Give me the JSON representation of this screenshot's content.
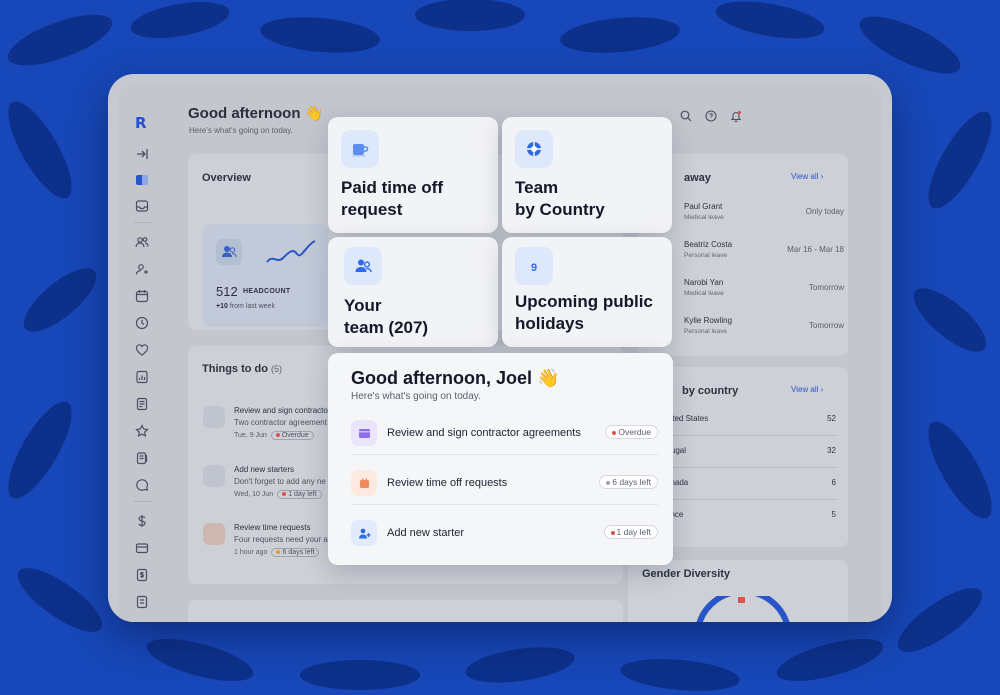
{
  "app": {
    "greeting_title": "Good afternoon 👋",
    "greeting_subtitle": "Here's what's going on today."
  },
  "overview": {
    "title": "Overview",
    "headcount_value": "512",
    "headcount_label": "HEADCOUNT",
    "headcount_delta": "+10",
    "headcount_delta_text": "from last week"
  },
  "things_to_do": {
    "title": "Things to do",
    "count": "(5)",
    "items": [
      {
        "title": "Review and sign contractor",
        "desc": "Two contractor agreement",
        "meta": "Tue, 9 Jun",
        "badge": "Overdue",
        "dot_color": "#d9534f"
      },
      {
        "title": "Add new starters",
        "desc": "Don't forget to add any ne",
        "meta": "Wed, 10 Jun",
        "badge": "1 day left",
        "dot_color": "#d9534f"
      },
      {
        "title": "Review time requests",
        "desc": "Four requests need your a",
        "meta": "1 hour ago",
        "badge": "6 days left",
        "dot_color": "#e0a030"
      }
    ]
  },
  "away": {
    "title": "away",
    "view_all": "View all",
    "people": [
      {
        "name": "Paul Grant",
        "type": "Medical leave",
        "when": "Only today"
      },
      {
        "name": "Beatriz Costa",
        "type": "Personal leave",
        "when": "Mar 16 - Mar 18"
      },
      {
        "name": "Narobi Yan",
        "type": "Medical leave",
        "when": "Tomorrow"
      },
      {
        "name": "Kylie Rowling",
        "type": "Personal leave",
        "when": "Tomorrow"
      }
    ]
  },
  "by_country": {
    "title": "by country",
    "view_all": "View all",
    "rows": [
      {
        "name": "nited States",
        "value": "52"
      },
      {
        "name": "rtugal",
        "value": "32"
      },
      {
        "name": "anada",
        "value": "6"
      },
      {
        "name": "ance",
        "value": "5"
      }
    ]
  },
  "gender": {
    "title": "Gender Diversity"
  },
  "cards": {
    "paid_time_off": "Paid time off\nrequest",
    "team_by_country": "Team\nby Country",
    "your_team": "Your\nteam (207)",
    "holidays": "Upcoming public\nholidays",
    "calendar_day": "9"
  },
  "tasks": {
    "title": "Good afternoon, Joel 👋",
    "subtitle": "Here's what's going on today.",
    "items": [
      {
        "label": "Review and sign contractor agreements",
        "badge": "Overdue",
        "dot_color": "#d9534f"
      },
      {
        "label": "Review time off requests",
        "badge": "6 days left",
        "dot_color": "#9aa0ac"
      },
      {
        "label": "Add new starter",
        "badge": "1 day left",
        "dot_color": "#d9534f"
      }
    ]
  },
  "colors": {
    "background": "#1747b8",
    "accent": "#2a55c8",
    "overdue": "#d9534f"
  }
}
